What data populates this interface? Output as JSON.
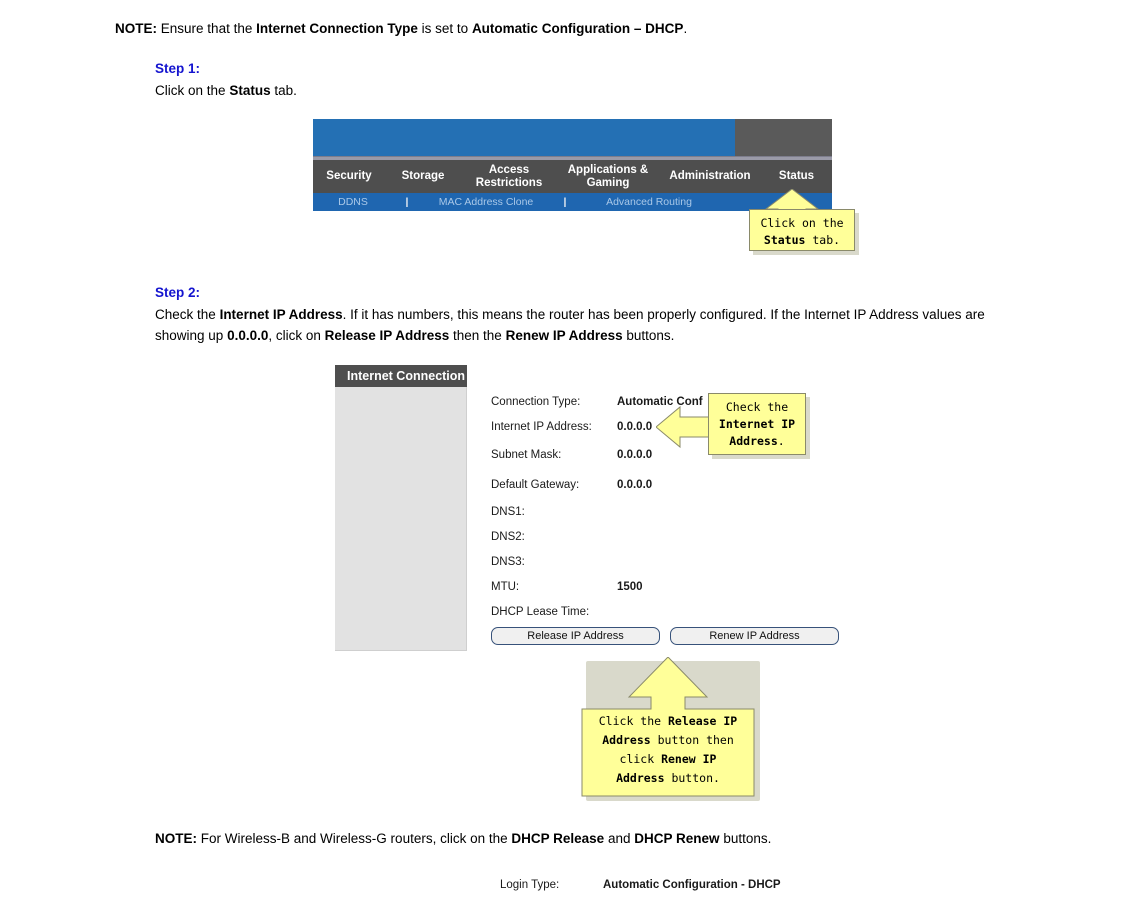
{
  "notes": {
    "top": {
      "prefix": "NOTE",
      "colon": ":",
      "part1": "Ensure that the",
      "bold1": "Internet Connection Type",
      "part2": "is set to",
      "bold2": "Automatic Configuration – DHCP",
      "end": "."
    },
    "bottom": {
      "prefix": "NOTE",
      "colon": ":",
      "part1": "For Wireless-B and Wireless-G routers, click on the",
      "bold1": "DHCP Release",
      "part2": "and",
      "bold2": "DHCP Renew",
      "part3": "buttons."
    }
  },
  "step1": {
    "label": "Step 1:",
    "text_pre": "Click on the",
    "text_bold": "Status",
    "text_post": "tab."
  },
  "step2": {
    "label": "Step 2:",
    "line1_a": "Check the",
    "line1_bold1": "Internet IP Address",
    "line1_b": ".  If it has numbers, this means the router has been properly configured.  If the Internet IP Address values are",
    "line2_a": "showing up",
    "line2_bold1": "0.0.0.0",
    "line2_b": ", click on",
    "line2_bold2": "Release IP Address",
    "line2_c": "then the",
    "line2_bold3": "Renew IP Address",
    "line2_d": "buttons."
  },
  "router_nav": {
    "tabs": [
      {
        "label": "Security"
      },
      {
        "label": "Storage"
      },
      {
        "label": "Access\nRestrictions",
        "line1": "Access",
        "line2": "Restrictions"
      },
      {
        "label": "Applications &\nGaming",
        "line1": "Applications &",
        "line2": "Gaming"
      },
      {
        "label": "Administration"
      },
      {
        "label": "Status"
      }
    ],
    "subnav": [
      {
        "label": "DDNS"
      },
      {
        "label": "|"
      },
      {
        "label": "MAC Address Clone"
      },
      {
        "label": "|"
      },
      {
        "label": "Advanced Routing"
      }
    ]
  },
  "callout_status": {
    "line1": "Click on the",
    "line2_bold": "Status",
    "line2_rest": " tab."
  },
  "callout_ip": {
    "line1": "Check the",
    "line2_bold": "Internet IP",
    "line3_bold": "Address",
    "line3_rest": "."
  },
  "callout_buttons": {
    "l1_a": "Click the ",
    "l1_bold": "Release IP",
    "l2_bold": "Address",
    "l2_a": " button then",
    "l3_a": "click ",
    "l3_bold": "Renew IP",
    "l4_bold": "Address",
    "l4_a": " button."
  },
  "panel": {
    "title": "Internet Connection",
    "fields": [
      {
        "label": "Connection Type:",
        "value": "Automatic Conf"
      },
      {
        "label": "Internet IP Address:",
        "value": "0.0.0.0"
      },
      {
        "label": "Subnet Mask:",
        "value": "0.0.0.0"
      },
      {
        "label": "Default Gateway:",
        "value": "0.0.0.0"
      },
      {
        "label": "DNS1:",
        "value": ""
      },
      {
        "label": "DNS2:",
        "value": ""
      },
      {
        "label": "DNS3:",
        "value": ""
      },
      {
        "label": "MTU:",
        "value": "1500"
      },
      {
        "label": "DHCP Lease Time:",
        "value": ""
      }
    ],
    "buttons": {
      "release": "Release IP Address",
      "renew": "Renew IP Address"
    }
  },
  "footer_row": {
    "label": "Login Type:",
    "value": "Automatic Configuration - DHCP"
  },
  "colors": {
    "blue_header": "#2470b4",
    "blue_subnav": "#1f66b0",
    "nav_gray": "#4e4e4e",
    "top_gray": "#5a5a5a",
    "panel_gray": "#e2e2e2",
    "callout_yellow": "#ffff99",
    "callout_border": "#8a8a6a",
    "step_blue": "#1414cf",
    "button_border": "#37527a"
  }
}
